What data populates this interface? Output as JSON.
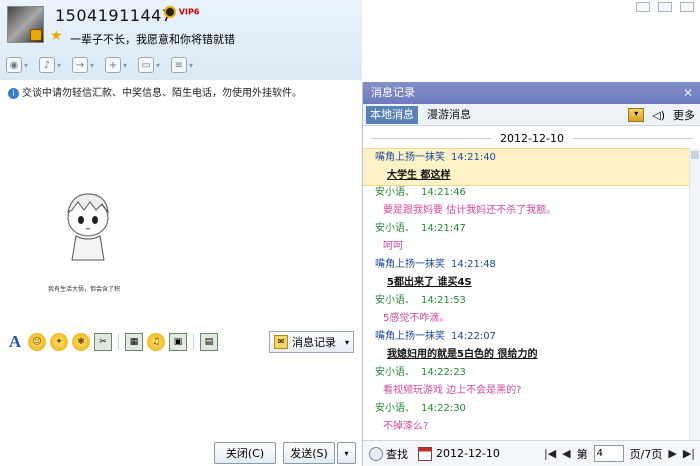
{
  "header": {
    "qq_number": "15041911447",
    "vip_label": "VIP6",
    "signature": "一辈子不长，我愿意和你将错就错"
  },
  "notice": "交谈中请勿轻信汇款、中奖信息、陌生电话，勿使用外挂软件。",
  "sketch_caption": "我有生活大悟，但会含了积",
  "format_bar": {
    "message_record_label": "消息记录"
  },
  "bottom": {
    "close_label": "关闭(C)",
    "send_label": "发送(S)"
  },
  "history": {
    "title": "消息记录",
    "tabs": [
      "本地消息",
      "漫游消息"
    ],
    "more_label": "更多",
    "date": "2012-12-10",
    "messages": [
      {
        "sender": "嘴角上扬一抹笑",
        "time": "14:21:40",
        "text": "大学生 都这样",
        "who": "me",
        "highlight": true
      },
      {
        "sender": "安小语、",
        "time": "14:21:46",
        "text": "要是跟我妈要 估计我妈还不杀了我额。",
        "who": "other"
      },
      {
        "sender": "安小语、",
        "time": "14:21:47",
        "text": "呵呵",
        "who": "other"
      },
      {
        "sender": "嘴角上扬一抹笑",
        "time": "14:21:48",
        "text": "5都出来了 谁买4S",
        "who": "me"
      },
      {
        "sender": "安小语、",
        "time": "14:21:53",
        "text": "5感觉不咋滴。",
        "who": "other"
      },
      {
        "sender": "嘴角上扬一抹笑",
        "time": "14:22:07",
        "text": "我媳妇用的就是5白色的  很给力的",
        "who": "me"
      },
      {
        "sender": "安小语、",
        "time": "14:22:23",
        "text": "看视频玩游戏 边上不会是黑的?",
        "who": "other"
      },
      {
        "sender": "安小语、",
        "time": "14:22:30",
        "text": "不掉漆么?",
        "who": "other"
      }
    ],
    "footer": {
      "search_label": "查找",
      "date": "2012-12-10",
      "page_prefix": "第",
      "page_value": "4",
      "page_suffix": "页/7页"
    }
  },
  "icons": {
    "emoji": "☺",
    "font": "A"
  }
}
